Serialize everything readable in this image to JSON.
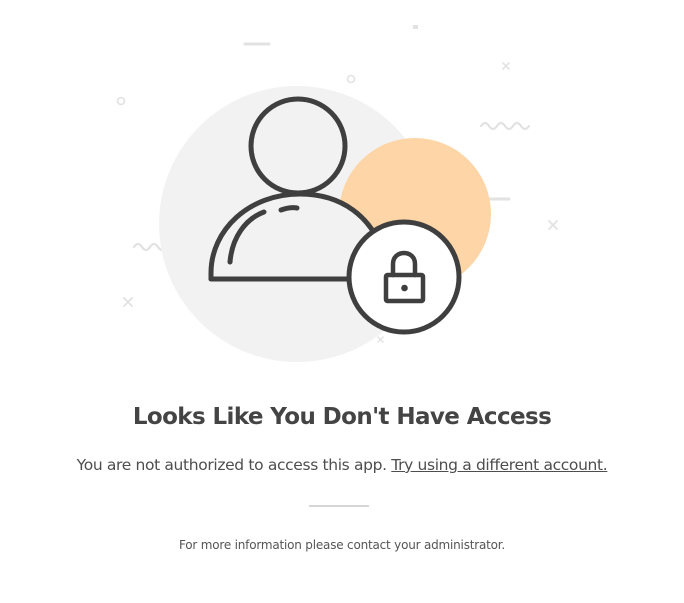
{
  "heading": "Looks Like You Don't Have Access",
  "message": {
    "text": "You are not authorized to access this app.",
    "link_label": "Try using a different account."
  },
  "footnote": "For more information please contact your administrator.",
  "colors": {
    "text": "#444444",
    "accent_peach": "#fdd5a6",
    "background_circle": "#f2f2f2",
    "icon_stroke": "#3f3f3f",
    "decor": "#e0e0e0"
  },
  "icons": [
    "user-silhouette-icon",
    "padlock-icon"
  ]
}
